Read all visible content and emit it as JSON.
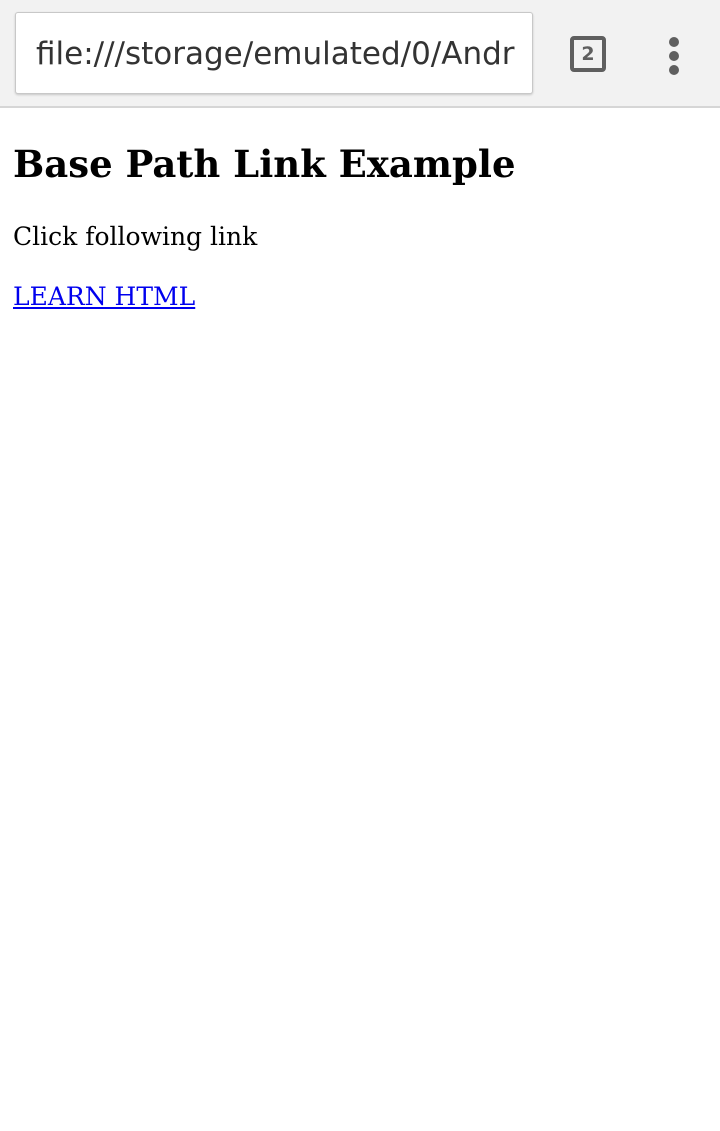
{
  "browser": {
    "url": "file:///storage/emulated/0/Andr",
    "tab_count": "2"
  },
  "page": {
    "heading": "Base Path Link Example",
    "intro_text": "Click following link",
    "link_text": "LEARN HTML"
  },
  "colors": {
    "toolbar_bg": "#f2f2f2",
    "link": "#0000ee",
    "icon": "#5f5f5f"
  },
  "icons": [
    "tabs-icon",
    "more-vertical-icon"
  ]
}
